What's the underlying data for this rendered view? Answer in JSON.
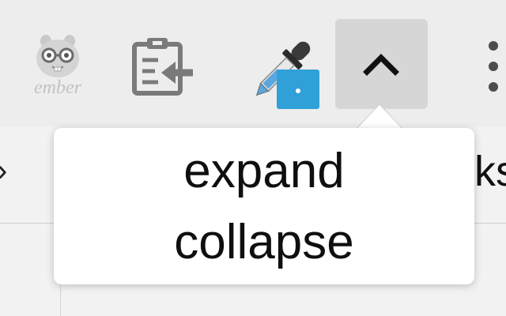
{
  "toolbar": {
    "icons": [
      {
        "name": "ember-inspector-icon",
        "logo_text": "ember"
      },
      {
        "name": "clipboard-import-icon"
      },
      {
        "name": "color-dropper-icon"
      },
      {
        "name": "chevron-up-icon"
      },
      {
        "name": "more-options-icon"
      }
    ],
    "active_button_color": "#d6d6d6",
    "dropper_badge_color": "#2fa0d8"
  },
  "background": {
    "left_arrow": "›",
    "right_partial_text": "ks"
  },
  "popover": {
    "items": [
      {
        "label": "expand"
      },
      {
        "label": "collapse"
      }
    ]
  }
}
